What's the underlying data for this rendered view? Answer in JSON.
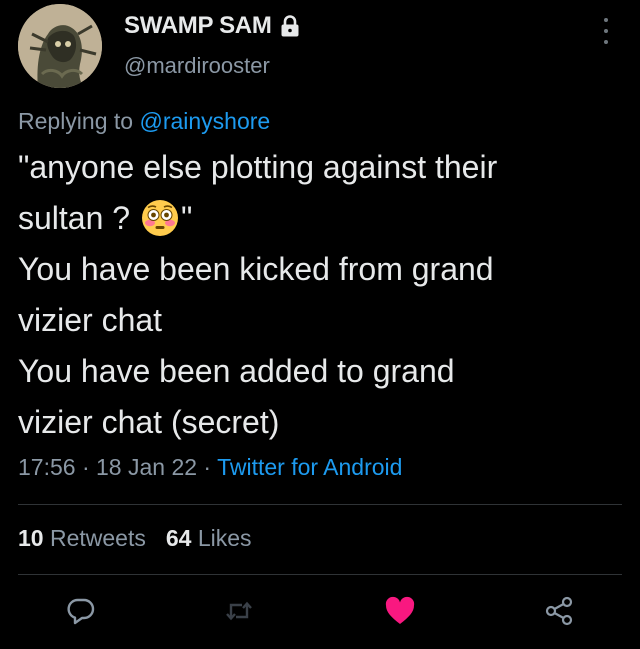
{
  "author": {
    "display_name": "SWAMP SAM",
    "handle": "@mardirooster",
    "protected": true
  },
  "reply": {
    "prefix": "Replying to",
    "mention": "@rainyshore"
  },
  "tweet": {
    "lines": [
      "\"anyone else plotting against their",
      "sultan ? ",
      "\"",
      "You have been kicked from grand",
      "vizier chat",
      "You have been added to grand",
      "vizier chat (secret)"
    ],
    "emoji": "flushed-face-emoji"
  },
  "meta": {
    "time": "17:56",
    "date": "18 Jan 22",
    "separator": " · ",
    "source": "Twitter for Android"
  },
  "stats": {
    "retweets_count": "10",
    "retweets_label": "Retweets",
    "likes_count": "64",
    "likes_label": "Likes"
  },
  "actions": {
    "reply_icon": "reply-icon",
    "retweet_icon": "retweet-icon",
    "like_icon": "heart-icon",
    "share_icon": "share-icon",
    "liked": true
  },
  "colors": {
    "background": "#000000",
    "text": "#e7e9ea",
    "secondary": "#8b98a5",
    "link": "#1d9bf0",
    "like": "#f91880",
    "divider": "#2f3336"
  }
}
